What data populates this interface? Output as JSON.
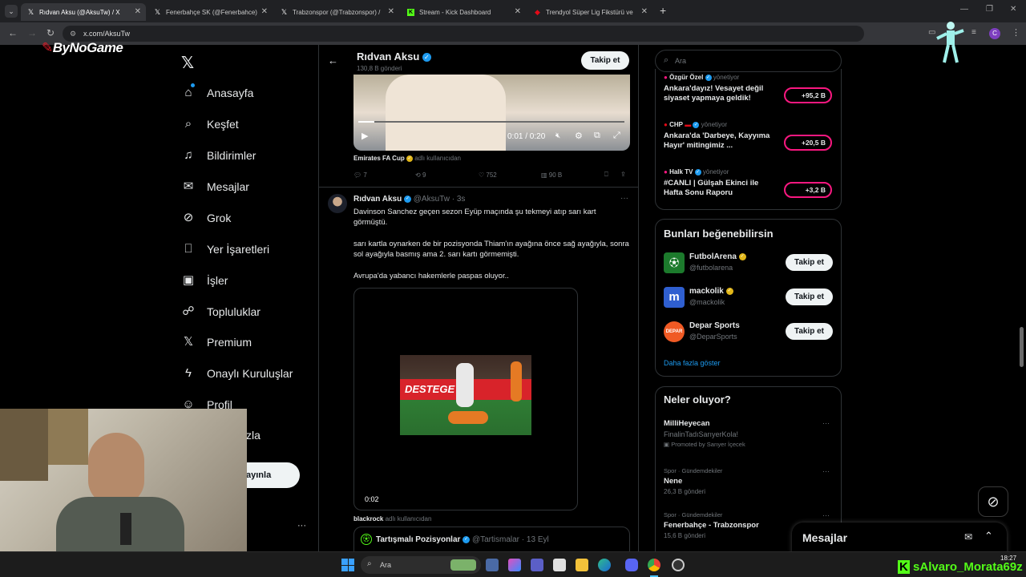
{
  "browser": {
    "tabs": [
      {
        "label": "Rıdvan Aksu (@AksuTw) / X",
        "active": true
      },
      {
        "label": "Fenerbahçe SK (@Fenerbahce) ",
        "active": false
      },
      {
        "label": "Trabzonspor (@Trabzonspor) / ",
        "active": false
      },
      {
        "label": "Stream - Kick Dashboard",
        "active": false
      },
      {
        "label": "Trendyol Süper Lig Fikstürü ve ",
        "active": false
      }
    ],
    "url": "x.com/AksuTw",
    "new_tab": "+"
  },
  "overlay": {
    "logo_text": "ByNoGame",
    "kick_user": "sAlvaro_Morata69z"
  },
  "nav": {
    "items": [
      {
        "label": "Anasayfa",
        "icon": "home-icon"
      },
      {
        "label": "Keşfet",
        "icon": "search-icon"
      },
      {
        "label": "Bildirimler",
        "icon": "bell-icon"
      },
      {
        "label": "Mesajlar",
        "icon": "mail-icon"
      },
      {
        "label": "Grok",
        "icon": "grok-icon"
      },
      {
        "label": "Yer İşaretleri",
        "icon": "bookmark-icon"
      },
      {
        "label": "İşler",
        "icon": "briefcase-icon"
      },
      {
        "label": "Topluluklar",
        "icon": "people-icon"
      },
      {
        "label": "Premium",
        "icon": "x-icon"
      },
      {
        "label": "Onaylı Kuruluşlar",
        "icon": "lightning-icon"
      },
      {
        "label": "Profil",
        "icon": "person-icon"
      },
      {
        "label": "zla",
        "icon": ""
      }
    ],
    "post_button": "ayınla",
    "more": "···"
  },
  "header": {
    "name": "Rıdvan Aksu",
    "posts_count": "130,8 B gönderi",
    "follow": "Takip et"
  },
  "post1": {
    "video_time": "0:01 / 0:20",
    "source": "Emirates FA Cup",
    "source_suffix": "adlı kullanıcıdan",
    "stats": {
      "replies": "7",
      "reposts": "9",
      "likes": "752",
      "views": "90 B"
    }
  },
  "post2": {
    "name": "Rıdvan Aksu",
    "handle": "@AksuTw",
    "time": "· 3s",
    "text1": "Davinson Sanchez geçen sezon Eyüp maçında şu tekmeyi atıp sarı kart görmüştü.",
    "text2": "sarı kartla oynarken de bir pozisyonda Thiam'ın ayağına önce sağ ayağıyla, sonra sol ayağıyla basmış ama 2. sarı kartı görmemişti.",
    "text3": "Avrupa'da yabancı hakemlerle paspas oluyor..",
    "video_time": "0:02",
    "clip_banner": "DESTEGE",
    "source": "blackrock",
    "source_suffix": "adlı kullanıcıdan",
    "quote_name": "Tartışmalı Pozisyonlar",
    "quote_handle": "@Tartismalar",
    "quote_time": "· 13 Eyl",
    "more": "···"
  },
  "search": {
    "placeholder": "Ara"
  },
  "live": [
    {
      "host": "Özgür Özel",
      "role": "yönetiyor",
      "title": "Ankara'dayız! Vesayet değil siyaset yapmaya geldik!",
      "count": "+95,2 B"
    },
    {
      "host": "CHP",
      "role": "yönetiyor",
      "title": "Ankara'da 'Darbeye, Kayyıma Hayır' mitingimiz ...",
      "count": "+20,5 B"
    },
    {
      "host": "Halk TV",
      "role": "yönetiyor",
      "title": "#CANLI | Gülşah Ekinci ile Hafta Sonu Raporu",
      "count": "+3,2 B"
    }
  ],
  "suggestions": {
    "title": "Bunları beğenebilirsin",
    "items": [
      {
        "name": "FutbolArena",
        "handle": "@futbolarena",
        "follow": "Takip et"
      },
      {
        "name": "mackolik",
        "handle": "@mackolik",
        "follow": "Takip et"
      },
      {
        "name": "Depar Sports",
        "handle": "@DeparSports",
        "follow": "Takip et"
      }
    ],
    "more": "Daha fazla göster"
  },
  "trends": {
    "title": "Neler oluyor?",
    "items": [
      {
        "top": "",
        "name": "MilliHeyecan",
        "sub": "FinalinTadıSarıyerKola!",
        "promo": "Promoted by Sarıyer İçecek"
      },
      {
        "top": "Spor · Gündemdekiler",
        "name": "Nene",
        "sub": "26,3 B gönderi",
        "promo": ""
      },
      {
        "top": "Spor · Gündemdekiler",
        "name": "Fenerbahçe - Trabzonspor",
        "sub": "15,6 B gönderi",
        "promo": ""
      }
    ]
  },
  "messages": {
    "title": "Mesajlar"
  },
  "taskbar": {
    "search": "Ara",
    "time": "18:27"
  },
  "colors": {
    "accent": "#1d9bf0",
    "live_ring": "#f91880",
    "kick_green": "#53fc18"
  }
}
